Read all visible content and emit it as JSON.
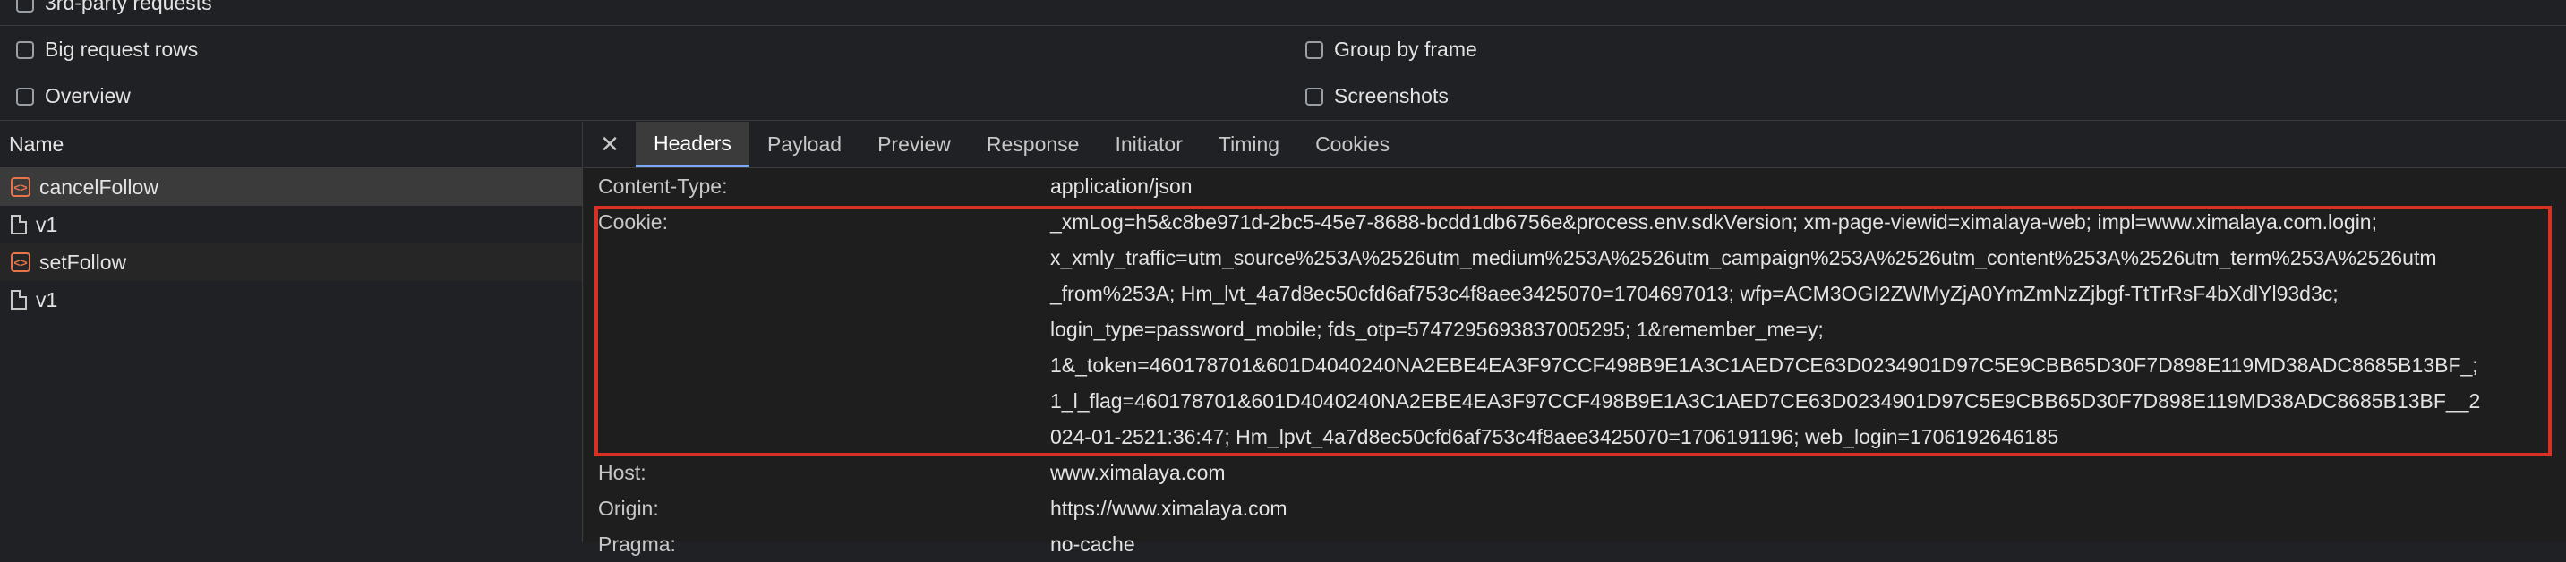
{
  "options": {
    "third_party": "3rd-party requests",
    "big_rows": "Big request rows",
    "group_by_frame": "Group by frame",
    "overview": "Overview",
    "screenshots": "Screenshots"
  },
  "name_panel": {
    "header": "Name",
    "requests": [
      {
        "name": "cancelFollow",
        "icon": "xhr-icon"
      },
      {
        "name": "v1",
        "icon": "document-icon"
      },
      {
        "name": "setFollow",
        "icon": "xhr-icon"
      },
      {
        "name": "v1",
        "icon": "document-icon"
      }
    ]
  },
  "tabs": [
    "Headers",
    "Payload",
    "Preview",
    "Response",
    "Initiator",
    "Timing",
    "Cookies"
  ],
  "headers": {
    "content_type": {
      "name": "Content-Type:",
      "value": "application/json"
    },
    "cookie": {
      "name": "Cookie:",
      "lines": [
        "_xmLog=h5&c8be971d-2bc5-45e7-8688-bcdd1db6756e&process.env.sdkVersion; xm-page-viewid=ximalaya-web; impl=www.ximalaya.com.login;",
        "x_xmly_traffic=utm_source%253A%2526utm_medium%253A%2526utm_campaign%253A%2526utm_content%253A%2526utm_term%253A%2526utm",
        "_from%253A; Hm_lvt_4a7d8ec50cfd6af753c4f8aee3425070=1704697013; wfp=ACM3OGI2ZWMyZjA0YmZmNzZjbgf-TtTrRsF4bXdlYl93d3c;",
        "login_type=password_mobile; fds_otp=5747295693837005295; 1&remember_me=y;",
        "1&_token=460178701&601D4040240NA2EBE4EA3F97CCF498B9E1A3C1AED7CE63D0234901D97C5E9CBB65D30F7D898E119MD38ADC8685B13BF_;",
        "1_l_flag=460178701&601D4040240NA2EBE4EA3F97CCF498B9E1A3C1AED7CE63D0234901D97C5E9CBB65D30F7D898E119MD38ADC8685B13BF__2",
        "024-01-2521:36:47; Hm_lpvt_4a7d8ec50cfd6af753c4f8aee3425070=1706191196; web_login=1706192646185"
      ]
    },
    "host": {
      "name": "Host:",
      "value": "www.ximalaya.com"
    },
    "origin": {
      "name": "Origin:",
      "value": "https://www.ximalaya.com"
    },
    "pragma": {
      "name": "Pragma:",
      "value": "no-cache"
    }
  },
  "colors": {
    "highlight_border": "#d93025",
    "active_tab_underline": "#7cacf8"
  }
}
